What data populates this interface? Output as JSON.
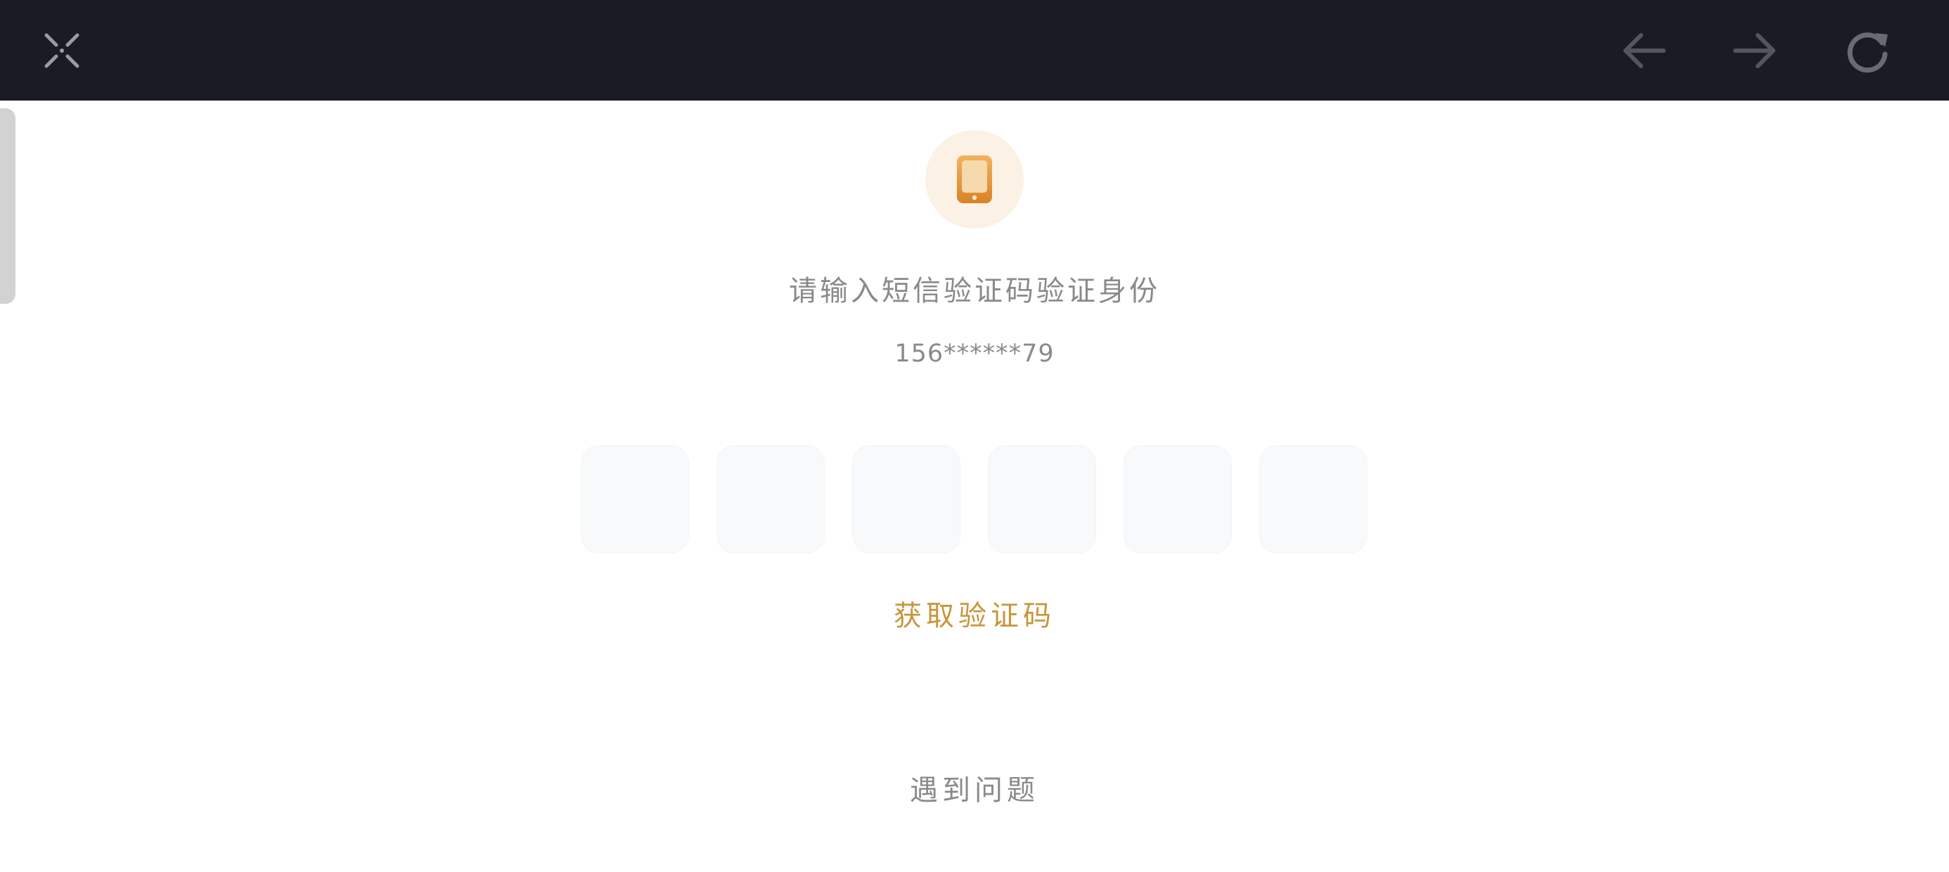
{
  "topbar": {
    "close_icon": "close-x-icon",
    "back_icon": "arrow-left-icon",
    "forward_icon": "arrow-right-icon",
    "refresh_icon": "refresh-icon",
    "background_color": "#1b1b24",
    "icon_color": "#5a5a62"
  },
  "verify": {
    "badge_icon": "smartphone-icon",
    "badge_color": "#e39b3e",
    "title": "请输入短信验证码验证身份",
    "phone_masked": "156******79",
    "code_boxes": [
      "",
      "",
      "",
      "",
      "",
      ""
    ],
    "get_code_label": "获取验证码",
    "accent_color": "#c9953b",
    "help_link": "遇到问题"
  }
}
